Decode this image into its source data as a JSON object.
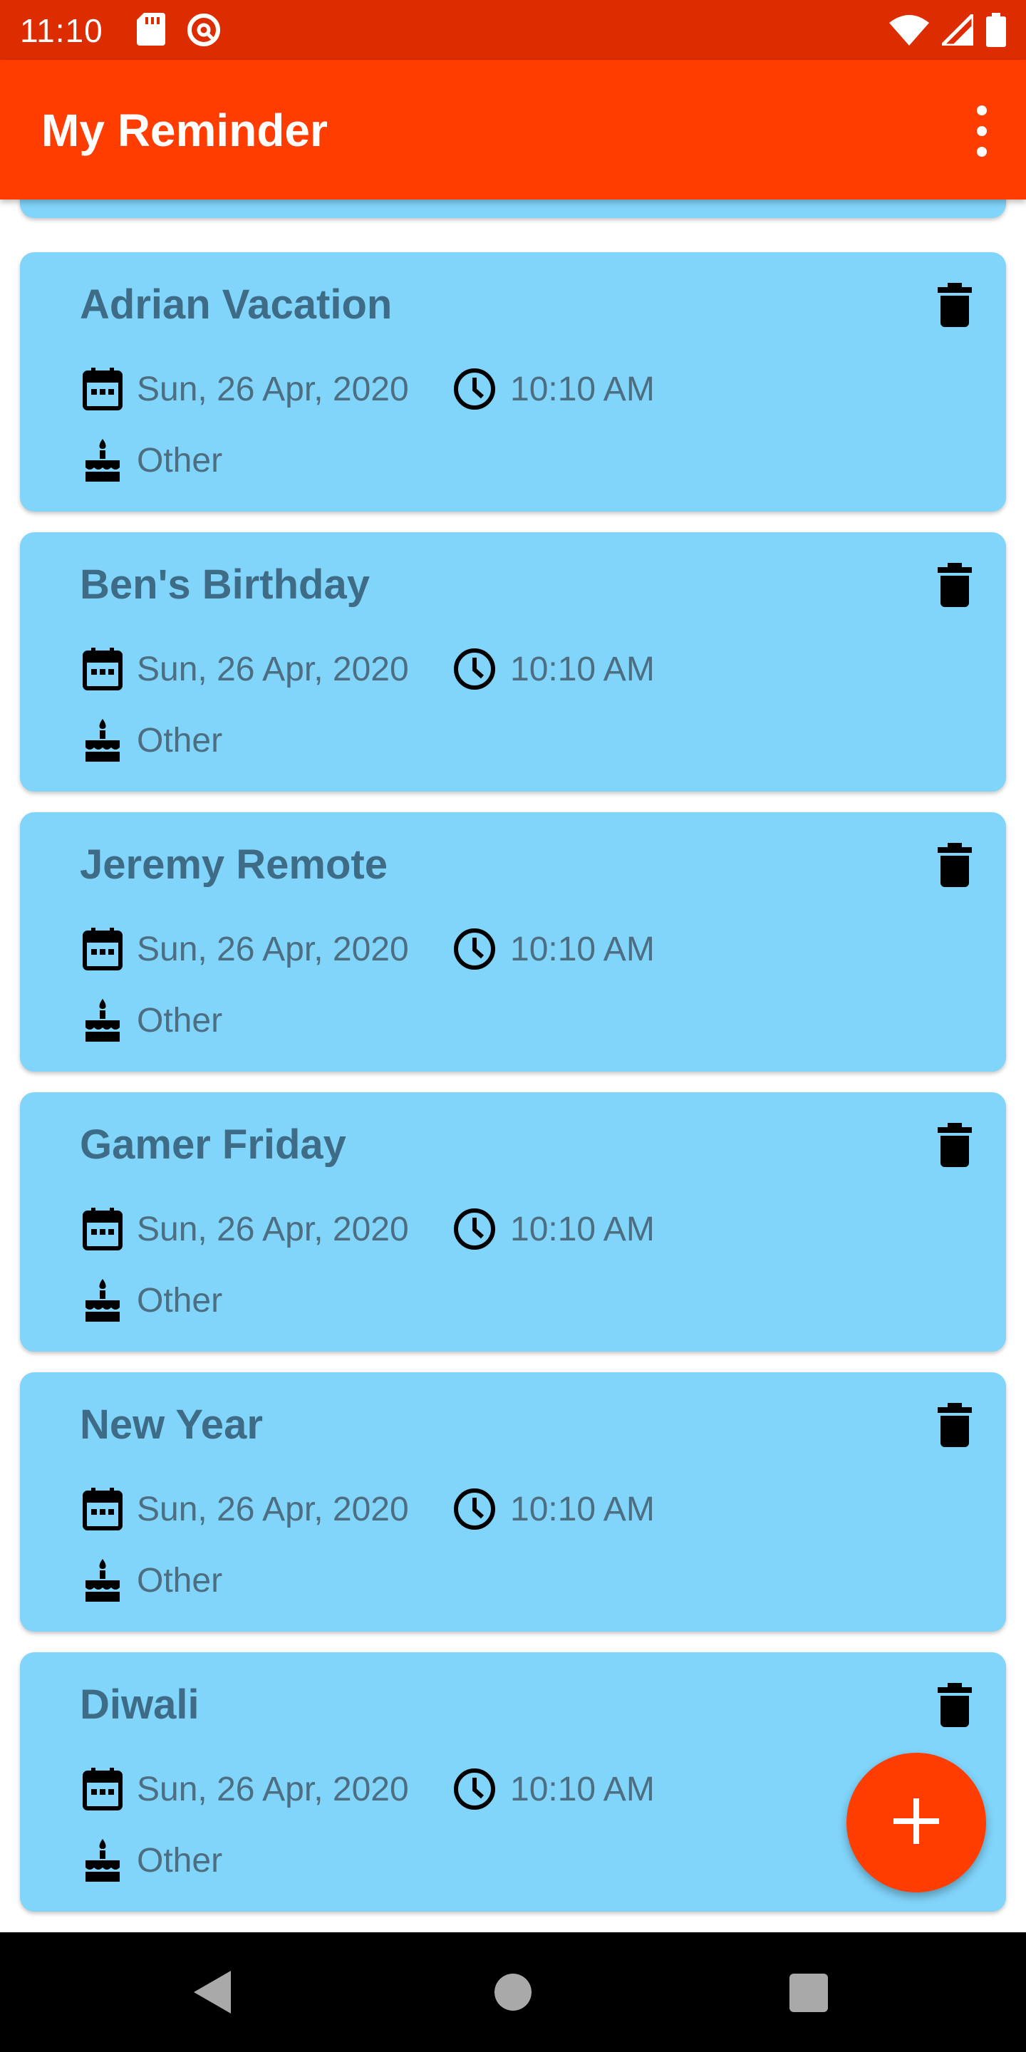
{
  "status_bar": {
    "time": "11:10",
    "left_icons": [
      "sd-card-icon",
      "at-sign-icon"
    ],
    "right_icons": [
      "wifi-icon",
      "cell-signal-icon",
      "battery-icon"
    ]
  },
  "app_bar": {
    "title": "My Reminder",
    "menu_icon": "overflow-menu-icon"
  },
  "reminders": [
    {
      "title": "Adrian Vacation",
      "date": "Sun, 26 Apr, 2020",
      "time": "10:10 AM",
      "category": "Other"
    },
    {
      "title": "Ben's Birthday",
      "date": "Sun, 26 Apr, 2020",
      "time": "10:10 AM",
      "category": "Other"
    },
    {
      "title": "Jeremy Remote",
      "date": "Sun, 26 Apr, 2020",
      "time": "10:10 AM",
      "category": "Other"
    },
    {
      "title": "Gamer Friday",
      "date": "Sun, 26 Apr, 2020",
      "time": "10:10 AM",
      "category": "Other"
    },
    {
      "title": "New Year",
      "date": "Sun, 26 Apr, 2020",
      "time": "10:10 AM",
      "category": "Other"
    },
    {
      "title": "Diwali",
      "date": "Sun, 26 Apr, 2020",
      "time": "10:10 AM",
      "category": "Other"
    }
  ],
  "fab": {
    "icon": "plus-icon"
  },
  "nav_bar": {
    "icons": [
      "back-icon",
      "home-icon",
      "recents-icon"
    ]
  },
  "colors": {
    "status_bar": "#dd2c00",
    "app_bar": "#ff3d00",
    "card": "#81d4fa",
    "title_text": "#3e6b85",
    "meta_text": "#4d6d80",
    "fab": "#ff3d00"
  }
}
